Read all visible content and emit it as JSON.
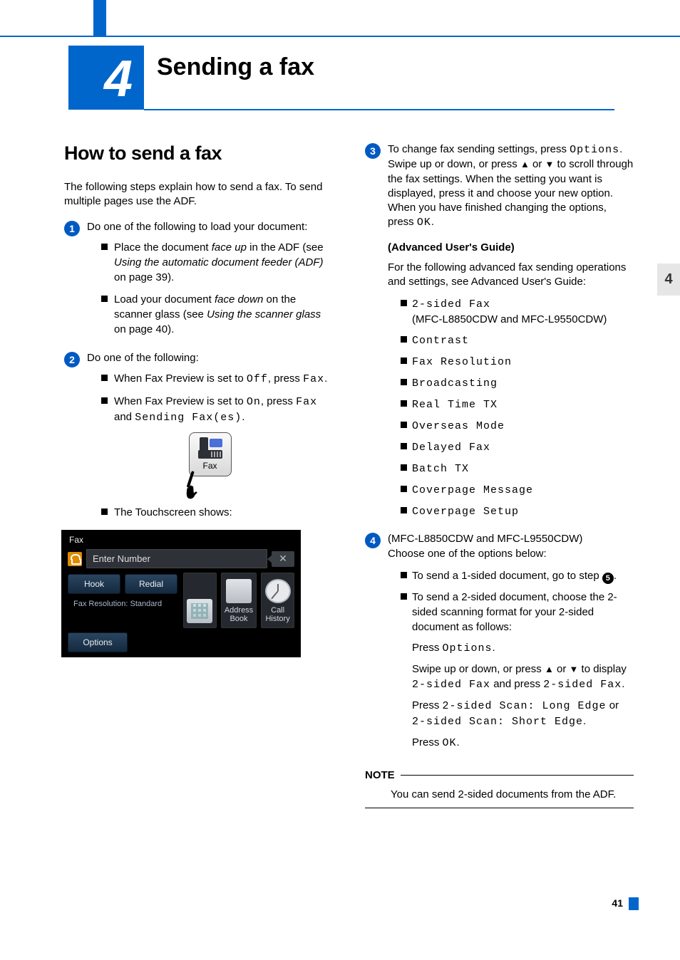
{
  "chapter": {
    "number": "4",
    "title": "Sending a fax",
    "side_tab": "4"
  },
  "section": {
    "title": "How to send a fax",
    "intro": "The following steps explain how to send a fax. To send multiple pages use the ADF."
  },
  "step1": {
    "text": "Do one of the following to load your document:",
    "b1_a": "Place the document ",
    "b1_b": "face up",
    "b1_c": " in the ADF (see ",
    "b1_d": "Using the automatic document feeder (ADF)",
    "b1_e": " on page 39).",
    "b2_a": "Load your document ",
    "b2_b": "face down",
    "b2_c": " on the scanner glass (see ",
    "b2_d": "Using the scanner glass",
    "b2_e": " on page 40)."
  },
  "step2": {
    "text": "Do one of the following:",
    "b1_a": "When Fax Preview is set to ",
    "b1_b": "Off",
    "b1_c": ", press ",
    "b1_d": "Fax",
    "b1_e": ".",
    "b2_a": "When Fax Preview is set to ",
    "b2_b": "On",
    "b2_c": ", press ",
    "b2_d": "Fax",
    "b2_e": " and ",
    "b2_f": "Sending Fax(es)",
    "b2_g": ".",
    "fax_label": "Fax",
    "touchscreen_label": "The Touchscreen shows:"
  },
  "touchscreen": {
    "title": "Fax",
    "placeholder": "Enter Number",
    "hook": "Hook",
    "redial": "Redial",
    "resolution": "Fax Resolution: Standard",
    "address_book": "Address\nBook",
    "call_history": "Call History",
    "options": "Options"
  },
  "step3": {
    "p1_a": "To change fax sending settings, press ",
    "p1_b": "Options",
    "p1_c": ". Swipe up or down, or press ",
    "p1_up": "▲",
    "p1_or": " or ",
    "p1_down": "▼",
    "p1_d": " to scroll through the fax settings. When the setting you want is displayed, press it and choose your new option. When you have finished changing the options, press ",
    "p1_e": "OK",
    "p1_f": ".",
    "adv_heading": "(Advanced User's Guide)",
    "adv_text": "For the following advanced fax sending operations and settings, see Advanced User's Guide:",
    "adv1": "2-sided Fax",
    "adv1_note": "(MFC-L8850CDW and MFC-L9550CDW)",
    "adv2": "Contrast",
    "adv3": "Fax Resolution",
    "adv4": "Broadcasting",
    "adv5": "Real Time TX",
    "adv6": "Overseas Mode",
    "adv7": "Delayed Fax",
    "adv8": "Batch TX",
    "adv9": "Coverpage Message",
    "adv10": "Coverpage Setup"
  },
  "step4": {
    "models": "(MFC-L8850CDW and MFC-L9550CDW)",
    "lead": "Choose one of the options below:",
    "b1_a": "To send a 1-sided document, go to step ",
    "b1_ref": "5",
    "b1_b": ".",
    "b2": "To send a 2-sided document, choose the 2-sided scanning format for your 2-sided document as follows:",
    "p1_a": "Press ",
    "p1_b": "Options",
    "p1_c": ".",
    "p2_a": "Swipe up or down, or press ",
    "p2_up": "▲",
    "p2_or": " or ",
    "p2_down": "▼",
    "p2_b": " to display ",
    "p2_c": "2-sided Fax",
    "p2_d": " and press ",
    "p2_e": "2-sided Fax",
    "p2_f": ".",
    "p3_a": "Press ",
    "p3_b": "2-sided Scan: Long Edge",
    "p3_c": " or ",
    "p3_d": "2-sided Scan: Short Edge",
    "p3_e": ".",
    "p4_a": "Press ",
    "p4_b": "OK",
    "p4_c": "."
  },
  "note": {
    "title": "NOTE",
    "body": "You can send 2-sided documents from the ADF."
  },
  "page_number": "41"
}
